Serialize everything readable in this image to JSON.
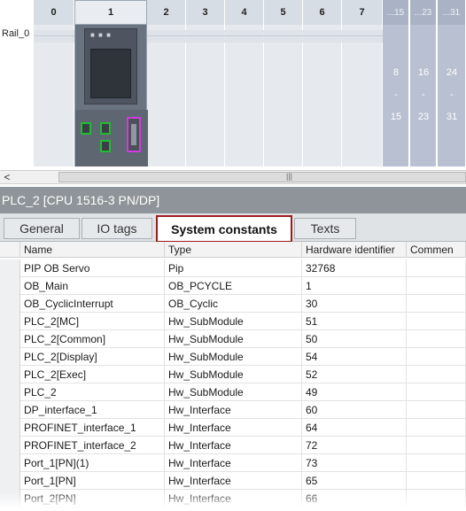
{
  "rack": {
    "rail_label": "Rail_0",
    "slots": [
      "0",
      "1",
      "2",
      "3",
      "4",
      "5",
      "6",
      "7"
    ],
    "ext_slots": [
      "...15",
      "...23",
      "...31"
    ],
    "ext_ranges": [
      {
        "from": "8",
        "dash": "-",
        "to": "15"
      },
      {
        "from": "16",
        "dash": "-",
        "to": "23"
      },
      {
        "from": "24",
        "dash": "-",
        "to": "31"
      }
    ]
  },
  "scroll": {
    "left_arrow": "<",
    "grip": "|||"
  },
  "device_title": "PLC_2 [CPU 1516-3 PN/DP]",
  "tabs": [
    "General",
    "IO tags",
    "System constants",
    "Texts"
  ],
  "active_tab": "System constants",
  "table": {
    "columns": [
      "Name",
      "Type",
      "Hardware identifier",
      "Commen"
    ],
    "rows": [
      [
        "PIP OB Servo",
        "Pip",
        "32768"
      ],
      [
        "OB_Main",
        "OB_PCYCLE",
        "1"
      ],
      [
        "OB_CyclicInterrupt",
        "OB_Cyclic",
        "30"
      ],
      [
        "PLC_2[MC]",
        "Hw_SubModule",
        "51"
      ],
      [
        "PLC_2[Common]",
        "Hw_SubModule",
        "50"
      ],
      [
        "PLC_2[Display]",
        "Hw_SubModule",
        "54"
      ],
      [
        "PLC_2[Exec]",
        "Hw_SubModule",
        "52"
      ],
      [
        "PLC_2",
        "Hw_SubModule",
        "49"
      ],
      [
        "DP_interface_1",
        "Hw_Interface",
        "60"
      ],
      [
        "PROFINET_interface_1",
        "Hw_Interface",
        "64"
      ],
      [
        "PROFINET_interface_2",
        "Hw_Interface",
        "72"
      ],
      [
        "Port_1[PN](1)",
        "Hw_Interface",
        "73"
      ],
      [
        "Port_1[PN]",
        "Hw_Interface",
        "65"
      ],
      [
        "Port_2[PN]",
        "Hw_Interface",
        "66"
      ]
    ]
  },
  "colors": {
    "active_tab_border": "#9e1b1b",
    "title_bar": "#8e9499",
    "port_green": "#22bb33",
    "port_pink": "#d23be0"
  }
}
